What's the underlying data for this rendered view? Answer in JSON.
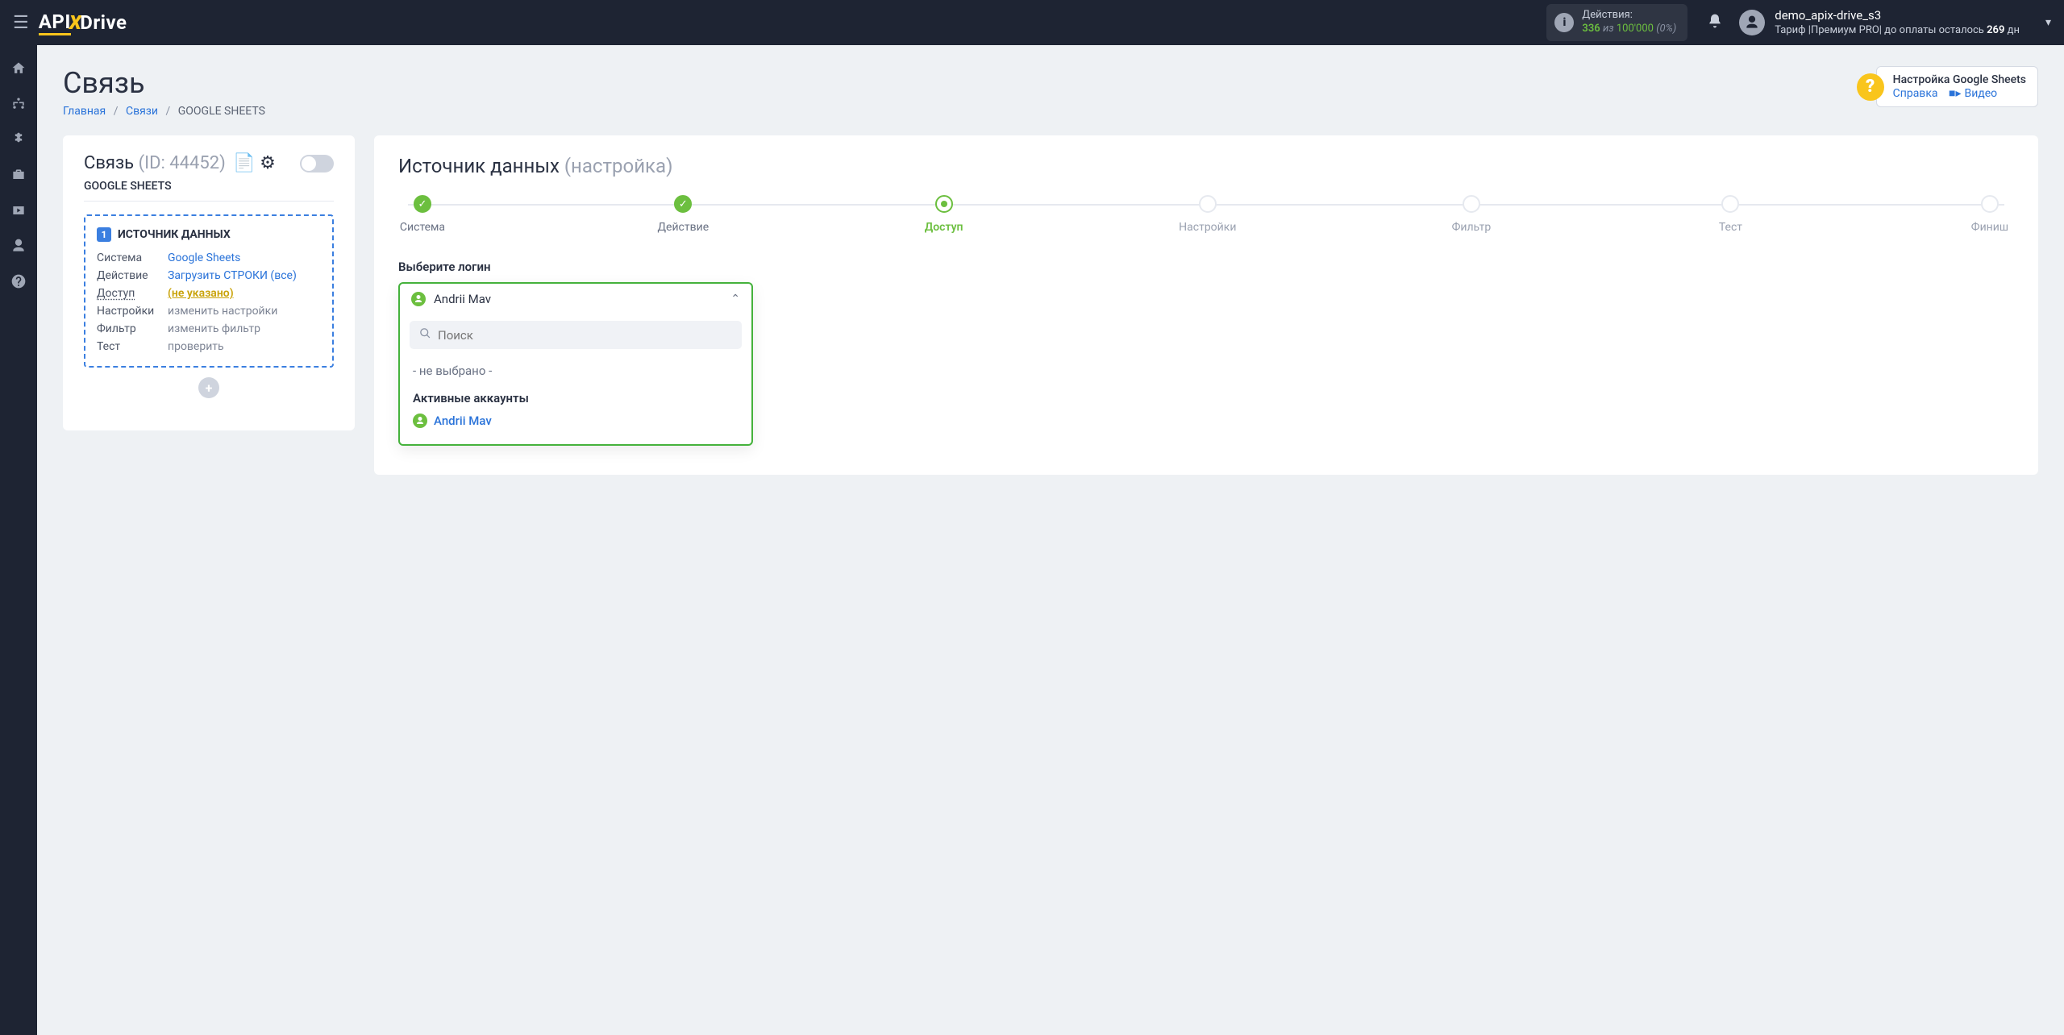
{
  "topbar": {
    "logo_pre": "API",
    "logo_x": "X",
    "logo_post": "Drive",
    "actions_label": "Действия:",
    "actions_used": "336",
    "actions_of": "из",
    "actions_max": "100'000",
    "actions_pct": "(0%)",
    "user_name": "demo_apix-drive_s3",
    "tariff_prefix": "Тариф |",
    "tariff_name": "Премиум PRO",
    "tariff_suffix": "| до оплаты осталось",
    "days_left": "269",
    "days_unit": "дн"
  },
  "page": {
    "title": "Связь",
    "crumbs": {
      "home": "Главная",
      "links": "Связи",
      "current": "GOOGLE SHEETS"
    }
  },
  "help": {
    "title": "Настройка Google Sheets",
    "doc": "Справка",
    "video": "Видео"
  },
  "left": {
    "title": "Связь",
    "id_label": "(ID: 44452)",
    "sub": "GOOGLE SHEETS",
    "source_heading": "ИСТОЧНИК ДАННЫХ",
    "rows": {
      "system_k": "Система",
      "system_v": "Google Sheets",
      "action_k": "Действие",
      "action_v": "Загрузить СТРОКИ (все)",
      "access_k": "Доступ",
      "access_v": "(не указано)",
      "settings_k": "Настройки",
      "settings_v": "изменить настройки",
      "filter_k": "Фильтр",
      "filter_v": "изменить фильтр",
      "test_k": "Тест",
      "test_v": "проверить"
    }
  },
  "right": {
    "title": "Источник данных",
    "title_sub": "(настройка)",
    "steps": [
      "Система",
      "Действие",
      "Доступ",
      "Настройки",
      "Фильтр",
      "Тест",
      "Финиш"
    ],
    "field_label": "Выберите логин",
    "selected_login": "Andrii Mav",
    "search_placeholder": "Поиск",
    "opt_none": "- не выбрано -",
    "group_label": "Активные аккаунты",
    "account_name": "Andrii Mav"
  }
}
